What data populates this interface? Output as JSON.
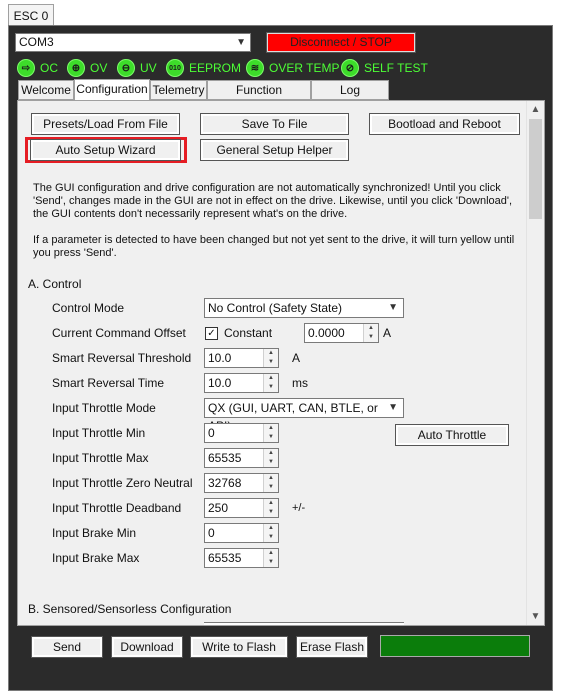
{
  "window": {
    "esc_tab": "ESC 0"
  },
  "connection": {
    "port": "COM3",
    "disconnect_label": "Disconnect / STOP"
  },
  "status": [
    {
      "label": "OC",
      "icon": "OC"
    },
    {
      "label": "OV",
      "icon": "⊕"
    },
    {
      "label": "UV",
      "icon": "⊖"
    },
    {
      "label": "EEPROM",
      "icon": "010"
    },
    {
      "label": "OVER TEMP",
      "icon": "≋"
    },
    {
      "label": "SELF TEST",
      "icon": "⊘"
    }
  ],
  "tabs": [
    {
      "label": "Welcome"
    },
    {
      "label": "Configuration"
    },
    {
      "label": "Telemetry"
    },
    {
      "label": "Function Generator"
    },
    {
      "label": "Log Download"
    }
  ],
  "toolbar": {
    "presets": "Presets/Load From File",
    "save": "Save To File",
    "bootload": "Bootload and Reboot",
    "auto_setup": "Auto Setup Wizard",
    "general_setup": "General Setup Helper"
  },
  "info": {
    "line1": "The GUI configuration and drive configuration are not automatically synchronized! Until you click",
    "line2": "'Send', changes made in the GUI are not in effect on the drive. Likewise, until you click 'Download',",
    "line3": "the GUI contents don't necessarily represent what's on the drive.",
    "line4": "If a parameter is detected to have been changed but not yet sent to the drive, it will turn yellow until",
    "line5": "you press 'Send'."
  },
  "section_a": {
    "title": "A. Control",
    "control_mode": {
      "label": "Control Mode",
      "value": "No Control (Safety State)"
    },
    "command_offset": {
      "label": "Current Command Offset",
      "checkbox_label": "Constant",
      "checked": true,
      "value": "0.0000",
      "unit": "A"
    },
    "reversal_threshold": {
      "label": "Smart Reversal Threshold",
      "value": "10.0",
      "unit": "A"
    },
    "reversal_time": {
      "label": "Smart Reversal Time",
      "value": "10.0",
      "unit": "ms"
    },
    "throttle_mode": {
      "label": "Input Throttle Mode",
      "value": "QX (GUI, UART, CAN, BTLE, or API)"
    },
    "throttle_min": {
      "label": "Input Throttle Min",
      "value": "0",
      "button": "Auto Throttle"
    },
    "throttle_max": {
      "label": "Input Throttle Max",
      "value": "65535"
    },
    "throttle_zero": {
      "label": "Input Throttle Zero Neutral",
      "value": "32768"
    },
    "throttle_deadband": {
      "label": "Input Throttle Deadband",
      "value": "250",
      "unit": "+/-"
    },
    "brake_min": {
      "label": "Input Brake Min",
      "value": "0"
    },
    "brake_max": {
      "label": "Input Brake Max",
      "value": "65535"
    }
  },
  "section_b": {
    "title": "B. Sensored/Sensorless Configuration"
  },
  "bottom": {
    "send": "Send",
    "download": "Download",
    "write_flash": "Write to Flash",
    "erase_flash": "Erase Flash"
  },
  "colors": {
    "panel_bg": "#2b2b2b",
    "status_green": "#4cff35",
    "disconnect_red": "#ff0000",
    "highlight_red": "#e51c23",
    "progress_green": "#0b7d0b"
  }
}
